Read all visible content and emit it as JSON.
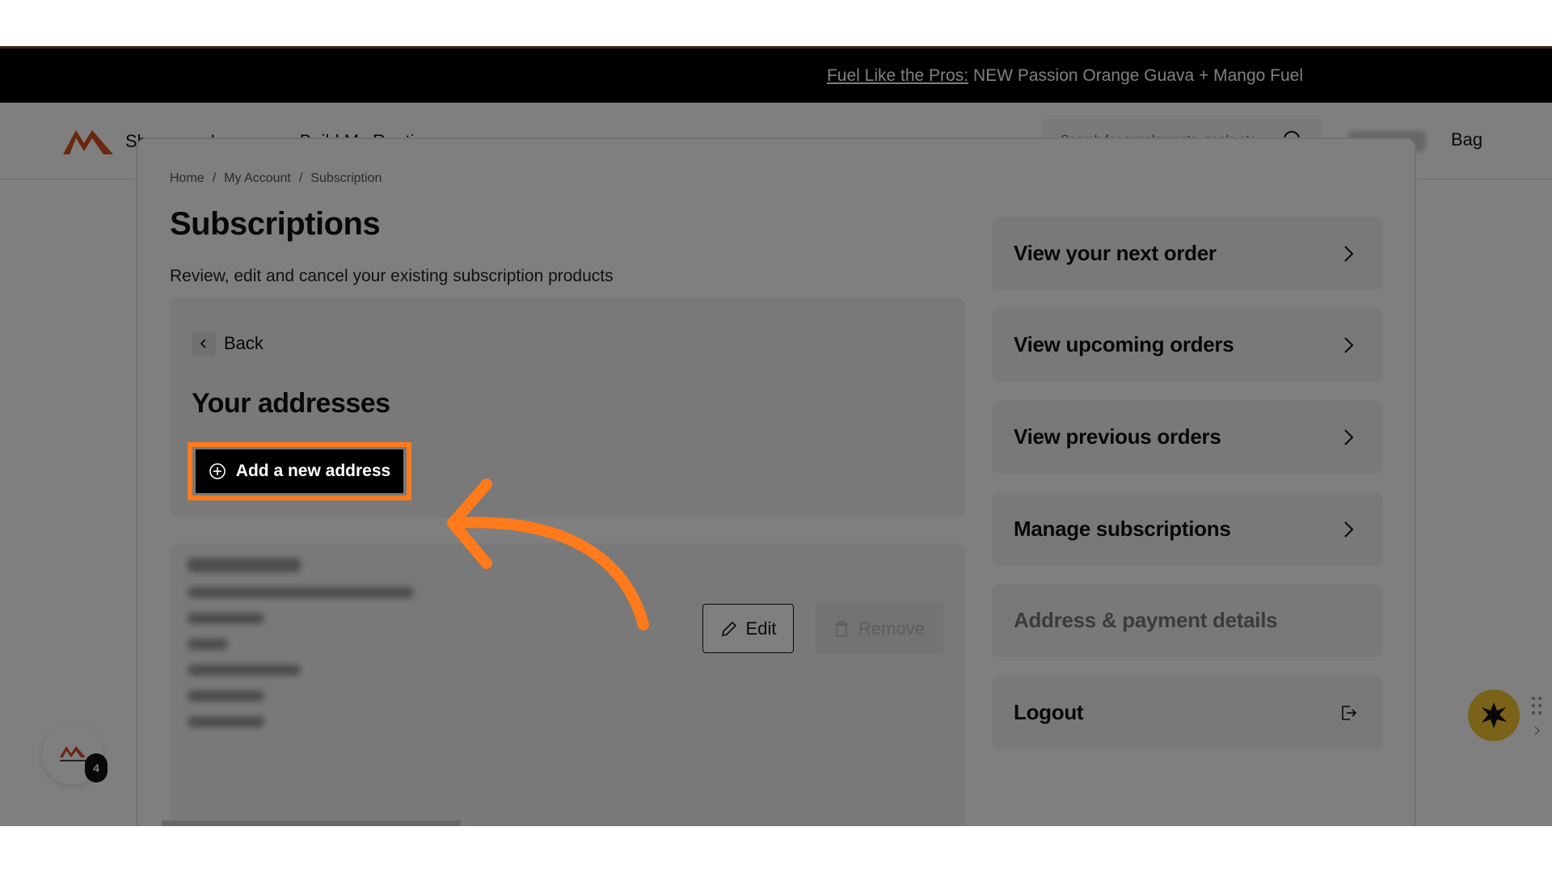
{
  "promo": {
    "link_text": "Fuel Like the Pros:",
    "text": "NEW Passion Orange Guava + Mango Fuel"
  },
  "nav": {
    "items": [
      {
        "label": "Shop",
        "has_dropdown": true
      },
      {
        "label": "Learn",
        "has_dropdown": true
      },
      {
        "label": "Build My Routine",
        "has_dropdown": false
      }
    ]
  },
  "search": {
    "placeholder": "Search for supplements, goals etc..."
  },
  "header": {
    "bag_label": "Bag"
  },
  "breadcrumb": {
    "items": [
      "Home",
      "My Account",
      "Subscription"
    ],
    "separator": "/"
  },
  "page": {
    "title": "Subscriptions",
    "description": "Review, edit and cancel your existing subscription products"
  },
  "addresses": {
    "back_label": "Back",
    "title": "Your addresses",
    "add_label": "Add a new address",
    "edit_label": "Edit",
    "remove_label": "Remove"
  },
  "sidebar": {
    "items": [
      {
        "label": "View your next order",
        "icon": "chevron-right-icon"
      },
      {
        "label": "View upcoming orders",
        "icon": "chevron-right-icon"
      },
      {
        "label": "View previous orders",
        "icon": "chevron-right-icon"
      },
      {
        "label": "Manage subscriptions",
        "icon": "chevron-right-icon"
      },
      {
        "label": "Address & payment details",
        "icon": "",
        "active": true
      },
      {
        "label": "Logout",
        "icon": "logout-icon"
      }
    ]
  },
  "chat_bubble": {
    "badge_count": "4"
  },
  "colors": {
    "highlight": "#ff7a1a",
    "brand": "#d4511e",
    "promo_bg": "#000000",
    "widget": "#f4c430"
  }
}
